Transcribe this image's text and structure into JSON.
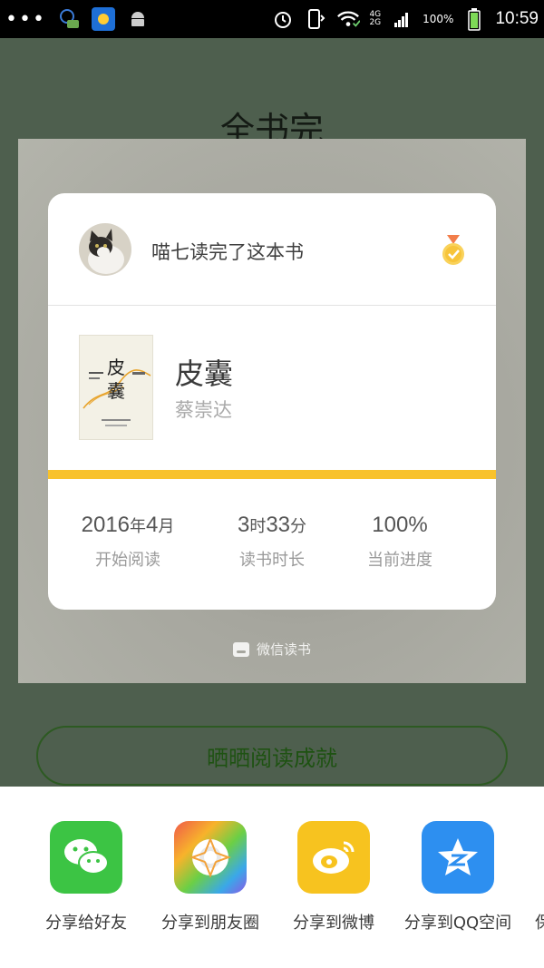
{
  "status_bar": {
    "time": "10:59",
    "battery": "100%",
    "network_top": "4G",
    "network_bottom": "2G"
  },
  "page": {
    "title": "全书完",
    "share_button": "晒晒阅读成就"
  },
  "card": {
    "user_line": "喵七读完了这本书",
    "book": {
      "title": "皮囊",
      "author": "蔡崇达",
      "cover_title": "皮囊"
    },
    "progress_fraction": 1.0,
    "stats": [
      {
        "value": "2016",
        "unit1": "年",
        "value2": "4",
        "unit2": "月",
        "label": "开始阅读"
      },
      {
        "value": "3",
        "unit1": "时",
        "value2": "33",
        "unit2": "分",
        "label": "读书时长"
      },
      {
        "value": "100%",
        "unit1": "",
        "value2": "",
        "unit2": "",
        "label": "当前进度"
      }
    ]
  },
  "brand": "微信读书",
  "share_sheet": {
    "items": [
      {
        "label": "分享给好友",
        "icon": "wechat-icon",
        "color": "#3cc444"
      },
      {
        "label": "分享到朋友圈",
        "icon": "moments-icon",
        "color": "#f05a4a"
      },
      {
        "label": "分享到微博",
        "icon": "weibo-icon",
        "color": "#f7c31f"
      },
      {
        "label": "分享到QQ空间",
        "icon": "qzone-icon",
        "color": "#2d8ff0"
      }
    ],
    "cut_label": "保"
  },
  "colors": {
    "accent": "#f8c22c",
    "page_bg": "#4e5f4e",
    "button_border": "#2d5a22"
  }
}
